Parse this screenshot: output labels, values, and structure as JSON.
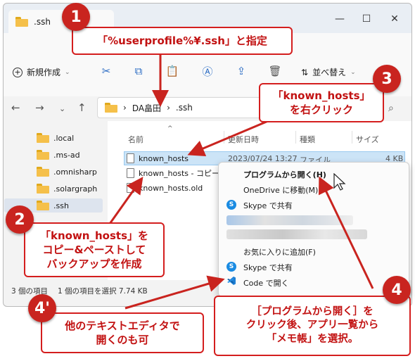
{
  "window": {
    "tab_title": ".ssh",
    "min_icon": "minimize-icon",
    "max_icon": "maximize-icon",
    "close_icon": "close-icon"
  },
  "commandbar": {
    "new_label": "新規作成",
    "sort_label": "並べ替え"
  },
  "address": {
    "crumbs": [
      "DA畠田",
      ".ssh"
    ],
    "separator": "›"
  },
  "sidebar": {
    "items": [
      ".local",
      ".ms-ad",
      ".omnisharp",
      ".solargraph",
      ".ssh"
    ]
  },
  "columns": {
    "name": "名前",
    "modified": "更新日時",
    "type": "種類",
    "size": "サイズ"
  },
  "files": [
    {
      "name": "known_hosts",
      "modified": "2023/07/24 13:27",
      "type": "ファイル",
      "size": "4 KB"
    },
    {
      "name": "known_hosts - コピー"
    },
    {
      "name": "known_hosts.old"
    }
  ],
  "statusbar": {
    "count": "3 個の項目",
    "selected": "1 個の項目を選択 7.74 KB"
  },
  "context_menu": {
    "open_with": "プログラムから開く(H)",
    "onedrive_move": "OneDrive に移動(M)",
    "skype_share_1": "Skype で共有",
    "favorites": "お気に入りに追加(F)",
    "skype_share_2": "Skype で共有",
    "code_open": "Code で開く"
  },
  "callouts": {
    "c1": {
      "badge": "1",
      "text": "「%userprofile%¥.ssh」と指定"
    },
    "c2": {
      "badge": "2",
      "lines": [
        "「known_hosts」を",
        "コピー&ペーストして",
        "バックアップを作成"
      ]
    },
    "c3": {
      "badge": "3",
      "lines": [
        "「known_hosts」",
        "を右クリック"
      ]
    },
    "c4": {
      "badge": "4",
      "lines": [
        "［プログラムから開く］を",
        "クリック後、アプリ一覧から",
        "「メモ帳」を選択。"
      ]
    },
    "c4p": {
      "badge": "4'",
      "lines": [
        "他のテキストエディタで",
        "開くのも可"
      ]
    }
  },
  "colors": {
    "accent_red": "#c9241f",
    "selection_blue": "#cce4f7",
    "folder_yellow": "#f5c04a"
  }
}
